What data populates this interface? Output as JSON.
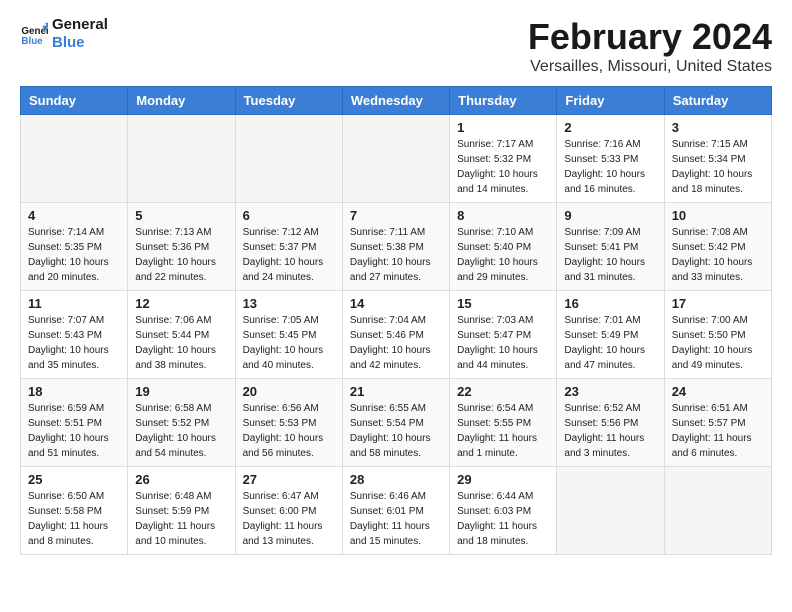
{
  "logo": {
    "line1": "General",
    "line2": "Blue"
  },
  "title": "February 2024",
  "subtitle": "Versailles, Missouri, United States",
  "weekdays": [
    "Sunday",
    "Monday",
    "Tuesday",
    "Wednesday",
    "Thursday",
    "Friday",
    "Saturday"
  ],
  "weeks": [
    [
      {
        "day": "",
        "info": ""
      },
      {
        "day": "",
        "info": ""
      },
      {
        "day": "",
        "info": ""
      },
      {
        "day": "",
        "info": ""
      },
      {
        "day": "1",
        "info": "Sunrise: 7:17 AM\nSunset: 5:32 PM\nDaylight: 10 hours\nand 14 minutes."
      },
      {
        "day": "2",
        "info": "Sunrise: 7:16 AM\nSunset: 5:33 PM\nDaylight: 10 hours\nand 16 minutes."
      },
      {
        "day": "3",
        "info": "Sunrise: 7:15 AM\nSunset: 5:34 PM\nDaylight: 10 hours\nand 18 minutes."
      }
    ],
    [
      {
        "day": "4",
        "info": "Sunrise: 7:14 AM\nSunset: 5:35 PM\nDaylight: 10 hours\nand 20 minutes."
      },
      {
        "day": "5",
        "info": "Sunrise: 7:13 AM\nSunset: 5:36 PM\nDaylight: 10 hours\nand 22 minutes."
      },
      {
        "day": "6",
        "info": "Sunrise: 7:12 AM\nSunset: 5:37 PM\nDaylight: 10 hours\nand 24 minutes."
      },
      {
        "day": "7",
        "info": "Sunrise: 7:11 AM\nSunset: 5:38 PM\nDaylight: 10 hours\nand 27 minutes."
      },
      {
        "day": "8",
        "info": "Sunrise: 7:10 AM\nSunset: 5:40 PM\nDaylight: 10 hours\nand 29 minutes."
      },
      {
        "day": "9",
        "info": "Sunrise: 7:09 AM\nSunset: 5:41 PM\nDaylight: 10 hours\nand 31 minutes."
      },
      {
        "day": "10",
        "info": "Sunrise: 7:08 AM\nSunset: 5:42 PM\nDaylight: 10 hours\nand 33 minutes."
      }
    ],
    [
      {
        "day": "11",
        "info": "Sunrise: 7:07 AM\nSunset: 5:43 PM\nDaylight: 10 hours\nand 35 minutes."
      },
      {
        "day": "12",
        "info": "Sunrise: 7:06 AM\nSunset: 5:44 PM\nDaylight: 10 hours\nand 38 minutes."
      },
      {
        "day": "13",
        "info": "Sunrise: 7:05 AM\nSunset: 5:45 PM\nDaylight: 10 hours\nand 40 minutes."
      },
      {
        "day": "14",
        "info": "Sunrise: 7:04 AM\nSunset: 5:46 PM\nDaylight: 10 hours\nand 42 minutes."
      },
      {
        "day": "15",
        "info": "Sunrise: 7:03 AM\nSunset: 5:47 PM\nDaylight: 10 hours\nand 44 minutes."
      },
      {
        "day": "16",
        "info": "Sunrise: 7:01 AM\nSunset: 5:49 PM\nDaylight: 10 hours\nand 47 minutes."
      },
      {
        "day": "17",
        "info": "Sunrise: 7:00 AM\nSunset: 5:50 PM\nDaylight: 10 hours\nand 49 minutes."
      }
    ],
    [
      {
        "day": "18",
        "info": "Sunrise: 6:59 AM\nSunset: 5:51 PM\nDaylight: 10 hours\nand 51 minutes."
      },
      {
        "day": "19",
        "info": "Sunrise: 6:58 AM\nSunset: 5:52 PM\nDaylight: 10 hours\nand 54 minutes."
      },
      {
        "day": "20",
        "info": "Sunrise: 6:56 AM\nSunset: 5:53 PM\nDaylight: 10 hours\nand 56 minutes."
      },
      {
        "day": "21",
        "info": "Sunrise: 6:55 AM\nSunset: 5:54 PM\nDaylight: 10 hours\nand 58 minutes."
      },
      {
        "day": "22",
        "info": "Sunrise: 6:54 AM\nSunset: 5:55 PM\nDaylight: 11 hours\nand 1 minute."
      },
      {
        "day": "23",
        "info": "Sunrise: 6:52 AM\nSunset: 5:56 PM\nDaylight: 11 hours\nand 3 minutes."
      },
      {
        "day": "24",
        "info": "Sunrise: 6:51 AM\nSunset: 5:57 PM\nDaylight: 11 hours\nand 6 minutes."
      }
    ],
    [
      {
        "day": "25",
        "info": "Sunrise: 6:50 AM\nSunset: 5:58 PM\nDaylight: 11 hours\nand 8 minutes."
      },
      {
        "day": "26",
        "info": "Sunrise: 6:48 AM\nSunset: 5:59 PM\nDaylight: 11 hours\nand 10 minutes."
      },
      {
        "day": "27",
        "info": "Sunrise: 6:47 AM\nSunset: 6:00 PM\nDaylight: 11 hours\nand 13 minutes."
      },
      {
        "day": "28",
        "info": "Sunrise: 6:46 AM\nSunset: 6:01 PM\nDaylight: 11 hours\nand 15 minutes."
      },
      {
        "day": "29",
        "info": "Sunrise: 6:44 AM\nSunset: 6:03 PM\nDaylight: 11 hours\nand 18 minutes."
      },
      {
        "day": "",
        "info": ""
      },
      {
        "day": "",
        "info": ""
      }
    ]
  ]
}
